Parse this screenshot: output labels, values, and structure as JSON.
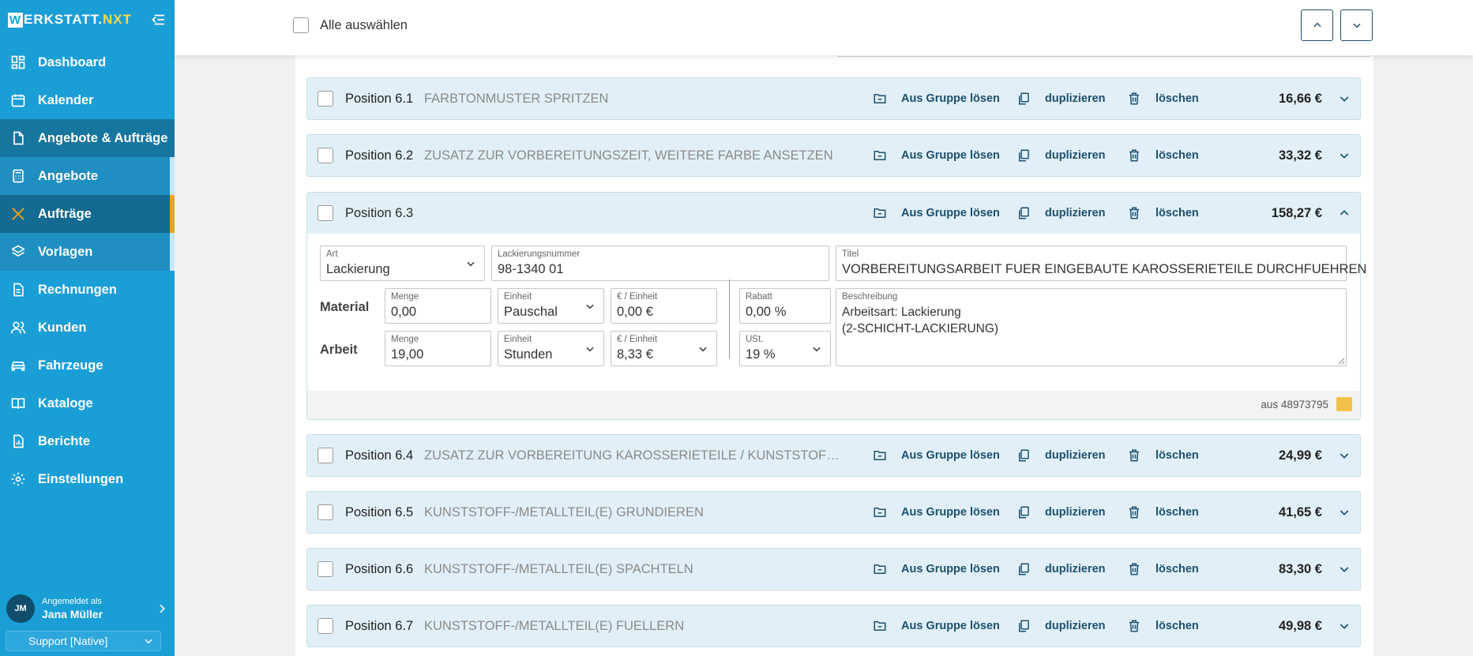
{
  "app": {
    "logo_w": "W",
    "logo_mid": "ERKSTATT.",
    "logo_nxt": "NXT"
  },
  "sidebar": {
    "items": [
      {
        "label": "Dashboard"
      },
      {
        "label": "Kalender"
      },
      {
        "label": "Angebote & Aufträge"
      },
      {
        "label": "Angebote"
      },
      {
        "label": "Aufträge"
      },
      {
        "label": "Vorlagen"
      },
      {
        "label": "Rechnungen"
      },
      {
        "label": "Kunden"
      },
      {
        "label": "Fahrzeuge"
      },
      {
        "label": "Kataloge"
      },
      {
        "label": "Berichte"
      },
      {
        "label": "Einstellungen"
      }
    ],
    "user": {
      "initials": "JM",
      "logged_in_as": "Angemeldet als",
      "name": "Jana Müller",
      "support": "Support [Native]"
    }
  },
  "topbar": {
    "select_all": "Alle auswählen"
  },
  "actions": {
    "ungroup": "Aus Gruppe lösen",
    "duplicate": "duplizieren",
    "delete": "löschen"
  },
  "positions": [
    {
      "name": "Position 6.1",
      "desc": "FARBTONMUSTER SPRITZEN",
      "price": "16,66 €"
    },
    {
      "name": "Position 6.2",
      "desc": "ZUSATZ ZUR VORBEREITUNGSZEIT, WEITERE FARBE ANSETZEN",
      "price": "33,32 €"
    },
    {
      "name": "Position 6.3",
      "desc": "",
      "price": "158,27 €"
    },
    {
      "name": "Position 6.4",
      "desc": "ZUSATZ ZUR VORBEREITUNG KAROSSERIETEILE / KUNSTSTOFFTEILE...",
      "price": "24,99 €"
    },
    {
      "name": "Position 6.5",
      "desc": "KUNSTSTOFF-/METALLTEIL(E) GRUNDIEREN",
      "price": "41,65 €"
    },
    {
      "name": "Position 6.6",
      "desc": "KUNSTSTOFF-/METALLTEIL(E) SPACHTELN",
      "price": "83,30 €"
    },
    {
      "name": "Position 6.7",
      "desc": "KUNSTSTOFF-/METALLTEIL(E) FUELLERN",
      "price": "49,98 €"
    }
  ],
  "detail": {
    "art_label": "Art",
    "art_value": "Lackierung",
    "lacknr_label": "Lackierungsnummer",
    "lacknr_value": "98-1340 01",
    "titel_label": "Titel",
    "titel_value": "VORBEREITUNGSARBEIT FUER EINGEBAUTE KAROSSERIETEILE DURCHFUEHREN",
    "material_label": "Material",
    "arbeit_label": "Arbeit",
    "menge_label": "Menge",
    "einheit_label": "Einheit",
    "preis_label": "€ / Einheit",
    "material_menge": "0,00",
    "material_einheit": "Pauschal",
    "material_preis": "0,00 €",
    "arbeit_menge": "19,00",
    "arbeit_einheit": "Stunden",
    "arbeit_preis": "8,33 €",
    "rabatt_label": "Rabatt",
    "rabatt_value": "0,00 %",
    "ust_label": "USt.",
    "ust_value": "19 %",
    "beschreibung_label": "Beschreibung",
    "beschreibung_line1": "Arbeitsart: Lackierung",
    "beschreibung_line2": "(2-SCHICHT-LACKIERUNG)",
    "source": "aus 48973795"
  },
  "colors": {
    "sidebar": "#1a9ed6",
    "sidebar_active": "#146a91",
    "accent": "#f2a31a",
    "row_bg": "#e1f0f8",
    "action_text": "#1e4f6e"
  }
}
